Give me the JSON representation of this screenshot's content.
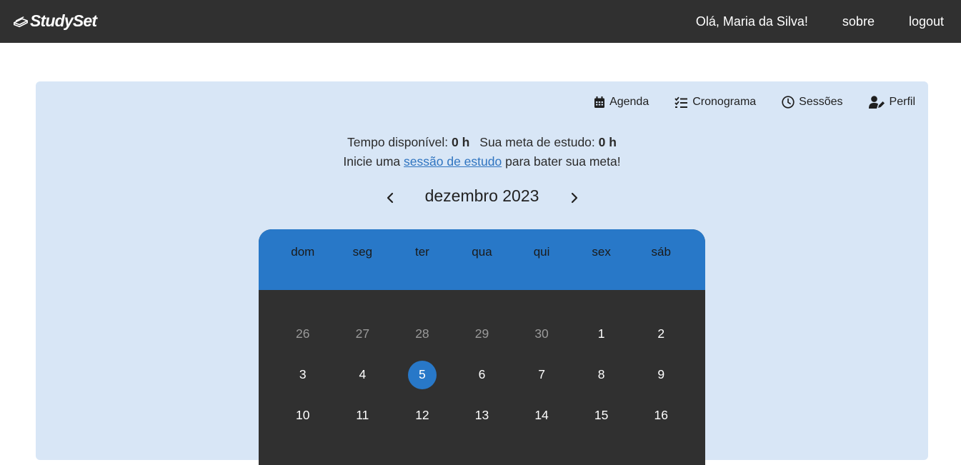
{
  "navbar": {
    "brand": "StudySet",
    "greeting": "Olá, Maria da Silva!",
    "about": "sobre",
    "logout": "logout"
  },
  "tabs": [
    {
      "label": "Agenda",
      "icon": "calendar-icon"
    },
    {
      "label": "Cronograma",
      "icon": "checklist-icon"
    },
    {
      "label": "Sessões",
      "icon": "clock-icon"
    },
    {
      "label": "Perfil",
      "icon": "user-edit-icon"
    }
  ],
  "summary": {
    "available_label": "Tempo disponível:",
    "available_value": "0 h",
    "goal_label": "Sua meta de estudo:",
    "goal_value": "0 h",
    "prompt_before": "Inicie uma",
    "prompt_link": "sessão de estudo",
    "prompt_after": "para bater sua meta!"
  },
  "calendar": {
    "month_title": "dezembro 2023",
    "weekdays": [
      "dom",
      "seg",
      "ter",
      "qua",
      "qui",
      "sex",
      "sáb"
    ],
    "weeks": [
      [
        {
          "d": "26",
          "muted": true
        },
        {
          "d": "27",
          "muted": true
        },
        {
          "d": "28",
          "muted": true
        },
        {
          "d": "29",
          "muted": true
        },
        {
          "d": "30",
          "muted": true
        },
        {
          "d": "1"
        },
        {
          "d": "2"
        }
      ],
      [
        {
          "d": "3"
        },
        {
          "d": "4"
        },
        {
          "d": "5",
          "today": true
        },
        {
          "d": "6"
        },
        {
          "d": "7"
        },
        {
          "d": "8"
        },
        {
          "d": "9"
        }
      ],
      [
        {
          "d": "10"
        },
        {
          "d": "11"
        },
        {
          "d": "12"
        },
        {
          "d": "13"
        },
        {
          "d": "14"
        },
        {
          "d": "15"
        },
        {
          "d": "16"
        }
      ]
    ]
  },
  "colors": {
    "navbar": "#303030",
    "panel": "#d8e6f6",
    "accent": "#2878c8",
    "calendar_body": "#303030",
    "link": "#2f74c0"
  }
}
